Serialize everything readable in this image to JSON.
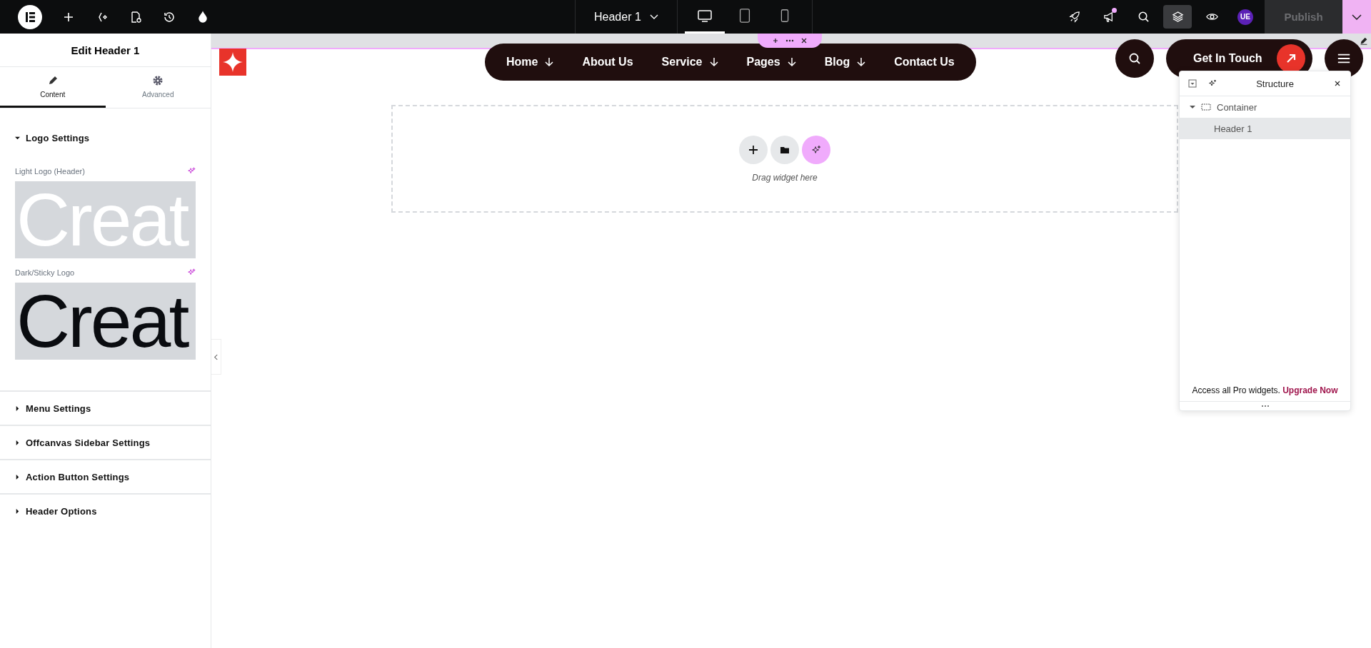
{
  "topbar": {
    "document": "Header 1",
    "devices": [
      {
        "kind": "desktop",
        "selected": true
      },
      {
        "kind": "tablet",
        "selected": false
      },
      {
        "kind": "mobile",
        "selected": false
      }
    ],
    "tools": [
      {
        "kind": "rocket",
        "selected": false,
        "notify": false
      },
      {
        "kind": "megaphone",
        "selected": false,
        "notify": true
      },
      {
        "kind": "search",
        "selected": false,
        "notify": false
      },
      {
        "kind": "layers",
        "selected": true,
        "notify": false
      },
      {
        "kind": "eye",
        "selected": false,
        "notify": false
      }
    ],
    "avatar": "UE",
    "publish": {
      "label": "Publish",
      "disabled": true
    }
  },
  "panel": {
    "title": "Edit Header 1",
    "tabs": [
      {
        "label": "Content",
        "kind": "pencil",
        "selected": true
      },
      {
        "label": "Advanced",
        "kind": "gear",
        "selected": false
      }
    ],
    "sections": [
      {
        "title": "Logo Settings",
        "expanded": true,
        "fields": [
          {
            "label": "Light Logo (Header)",
            "logo_text": "Creat",
            "kind": "light"
          },
          {
            "label": "Dark/Sticky Logo",
            "logo_text": "Creat",
            "kind": "dark"
          }
        ]
      },
      {
        "title": "Menu Settings",
        "expanded": false
      },
      {
        "title": "Offcanvas Sidebar Settings",
        "expanded": false
      },
      {
        "title": "Action Button Settings",
        "expanded": false
      },
      {
        "title": "Header Options",
        "expanded": false
      }
    ]
  },
  "canvas": {
    "nav": [
      {
        "label": "Home",
        "dropdown": true
      },
      {
        "label": "About Us",
        "dropdown": false
      },
      {
        "label": "Service",
        "dropdown": true
      },
      {
        "label": "Pages",
        "dropdown": true
      },
      {
        "label": "Blog",
        "dropdown": true
      },
      {
        "label": "Contact Us",
        "dropdown": false
      }
    ],
    "cta": "Get In Touch",
    "drop_zone": {
      "hint": "Drag widget here"
    }
  },
  "structure": {
    "title": "Structure",
    "tree": [
      {
        "label": "Container",
        "expanded": true,
        "selected": false,
        "children": [
          {
            "label": "Header 1",
            "selected": true
          }
        ]
      }
    ],
    "promo": {
      "text": "Access all Pro widgets.",
      "link": "Upgrade Now"
    }
  }
}
